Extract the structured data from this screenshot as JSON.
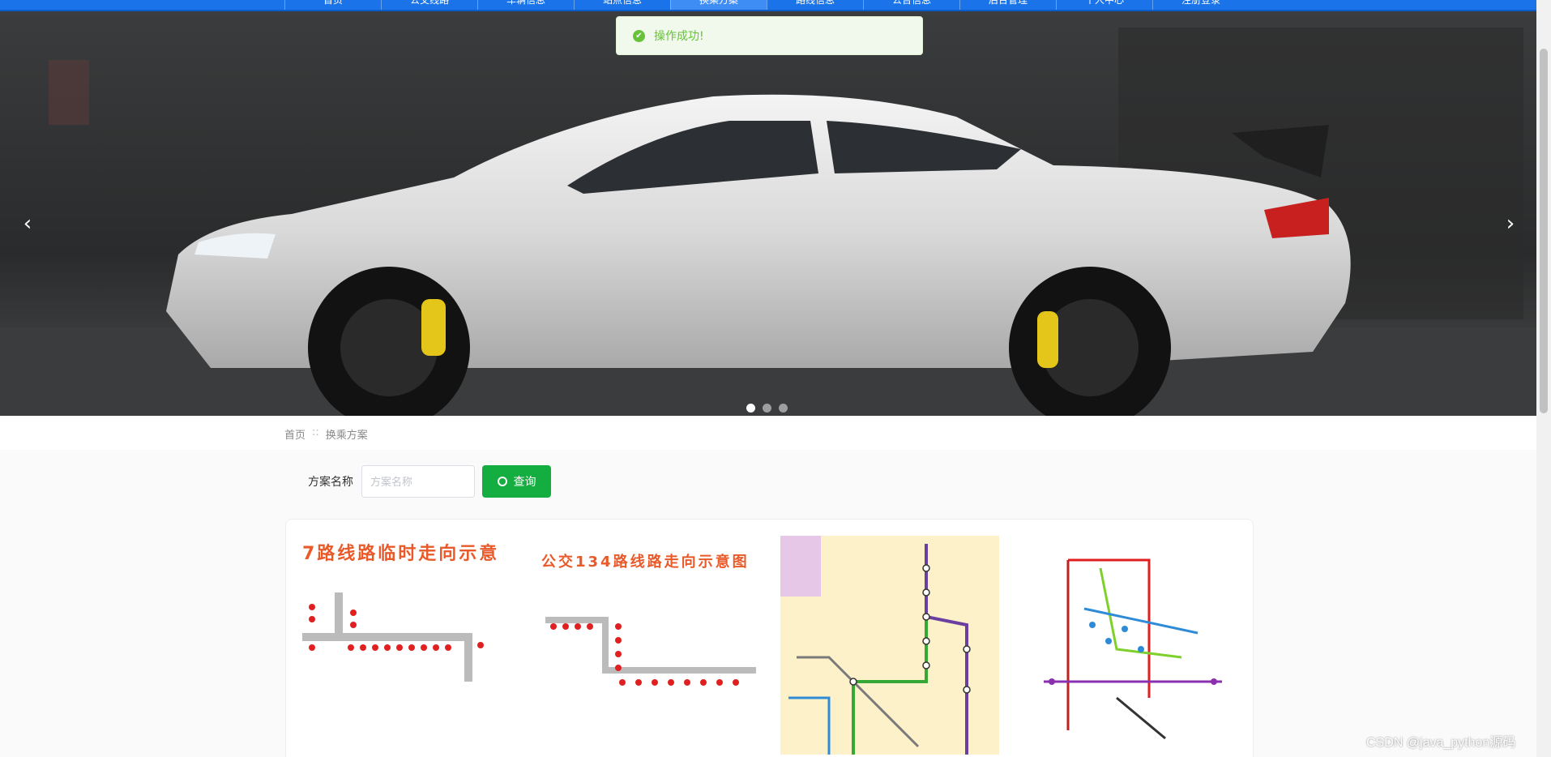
{
  "nav": {
    "items": [
      "首页",
      "公交线路",
      "车辆信息",
      "站点信息",
      "换乘方案",
      "路线信息",
      "公告信息",
      "后台管理",
      "个人中心",
      "注册登录"
    ],
    "active_index": 4
  },
  "carousel": {
    "slide_count": 3,
    "active_slide": 1,
    "prev_glyph": "‹",
    "next_glyph": "›"
  },
  "toast": {
    "message": "操作成功!",
    "type": "success",
    "icon": "check-circle-icon"
  },
  "breadcrumb": {
    "home": "首页",
    "separator": "::",
    "current": "换乘方案"
  },
  "search": {
    "label": "方案名称",
    "placeholder": "方案名称",
    "value": "",
    "button_label": "查询",
    "button_icon": "search-icon"
  },
  "plans": [
    {
      "title": "7路线路临时走向示意"
    },
    {
      "title": "公交134路线路走向示意图"
    },
    {
      "title": ""
    },
    {
      "title": ""
    }
  ],
  "watermark": "CSDN @java_python源码",
  "colors": {
    "nav": "#1a73e8",
    "primary_button": "#13ae3f",
    "toast_text": "#67c23a",
    "route_title": "#e85a2a"
  }
}
